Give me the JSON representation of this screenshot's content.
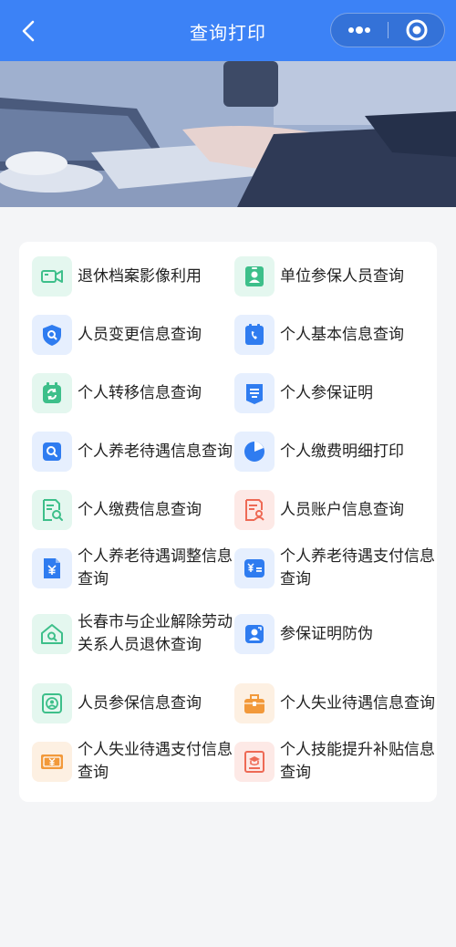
{
  "nav": {
    "title": "查询打印"
  },
  "items": [
    {
      "label": "退休档案影像利用"
    },
    {
      "label": "单位参保人员查询"
    },
    {
      "label": "人员变更信息查询"
    },
    {
      "label": "个人基本信息查询"
    },
    {
      "label": "个人转移信息查询"
    },
    {
      "label": "个人参保证明"
    },
    {
      "label": "个人养老待遇信息查询"
    },
    {
      "label": "个人缴费明细打印"
    },
    {
      "label": "个人缴费信息查询"
    },
    {
      "label": "人员账户信息查询"
    },
    {
      "label": "个人养老待遇调整信息查询"
    },
    {
      "label": "个人养老待遇支付信息查询"
    },
    {
      "label": "长春市与企业解除劳动关系人员退休查询"
    },
    {
      "label": "参保证明防伪"
    },
    {
      "label": "人员参保信息查询"
    },
    {
      "label": "个人失业待遇信息查询"
    },
    {
      "label": "个人失业待遇支付信息查询"
    },
    {
      "label": "个人技能提升补贴信息查询"
    }
  ],
  "colors": {
    "nav": "#3c82f6",
    "green": "#3dbf8a",
    "blue": "#2f7cf0",
    "orange": "#f2993a",
    "red": "#ee6a55"
  }
}
